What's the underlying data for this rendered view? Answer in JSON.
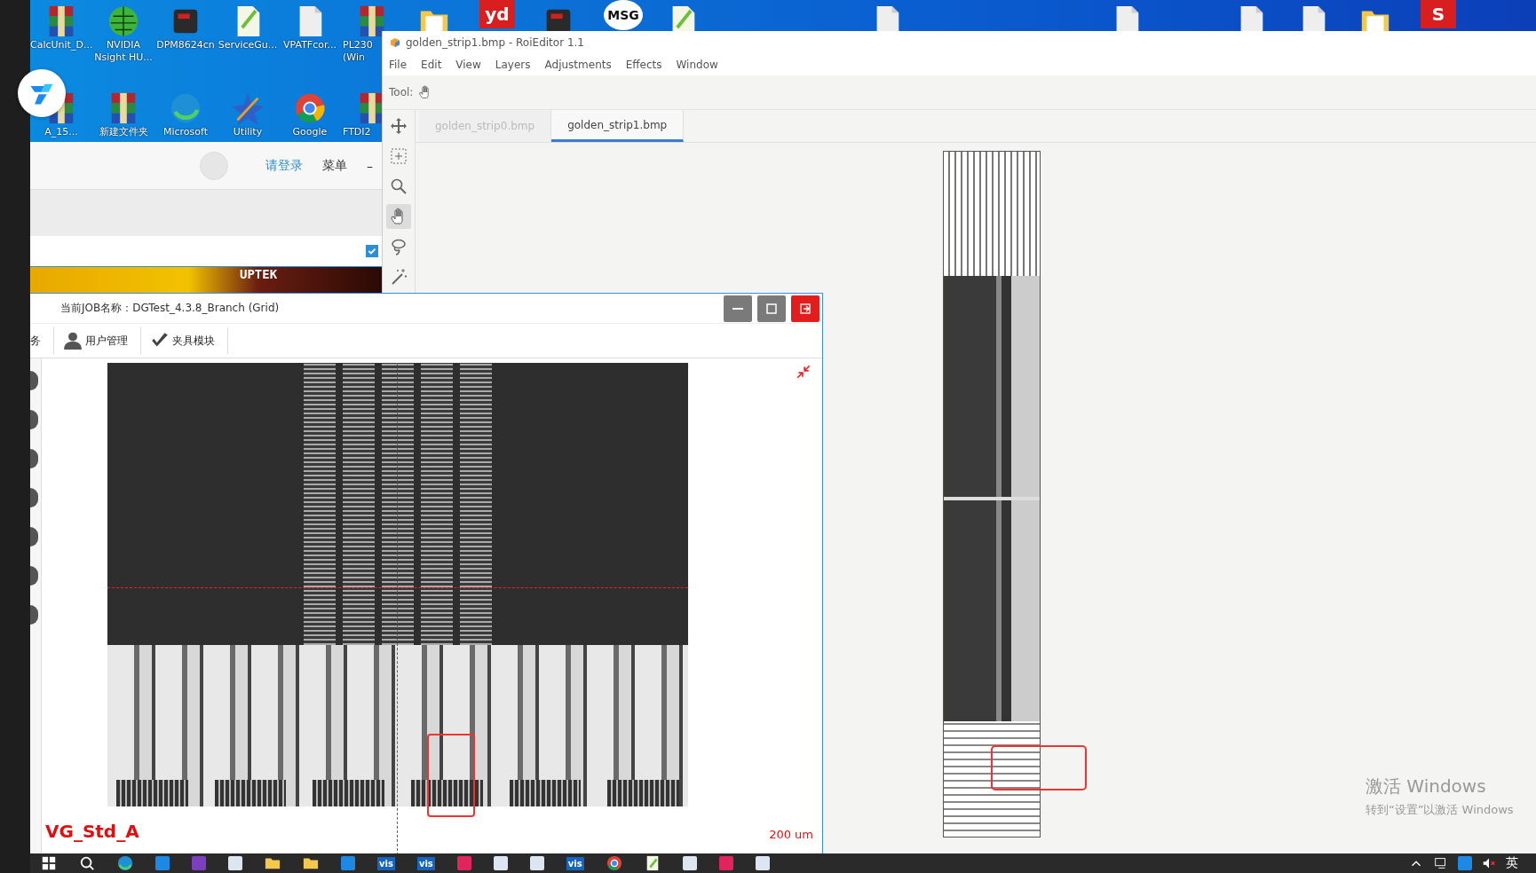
{
  "desktop": {
    "icons": [
      {
        "label": "CalcUnit_D...",
        "kind": "archive"
      },
      {
        "label": "NVIDIA Nsight HU...",
        "kind": "sphere"
      },
      {
        "label": "DPM8624cn",
        "kind": "device"
      },
      {
        "label": "ServiceGu...",
        "kind": "notepad"
      },
      {
        "label": "VPATFcor...",
        "kind": "file"
      },
      {
        "label": "PL230 (Win",
        "kind": "archive"
      },
      {
        "label": "A_15...",
        "kind": "archive"
      },
      {
        "label": "新建文件夹",
        "kind": "archive"
      },
      {
        "label": "Microsoft",
        "kind": "swirl"
      },
      {
        "label": "Utility",
        "kind": "tools"
      },
      {
        "label": "Google",
        "kind": "ring"
      },
      {
        "label": "FTDI2",
        "kind": "archive"
      }
    ],
    "top_icons": [
      {
        "kind": "folder"
      },
      {
        "kind": "tile",
        "label": "yd"
      },
      {
        "kind": "device"
      },
      {
        "kind": "badge",
        "label": "MSG"
      },
      {
        "kind": "notepad"
      },
      {
        "kind": "file"
      },
      {
        "kind": "file"
      },
      {
        "kind": "file"
      },
      {
        "kind": "file"
      },
      {
        "kind": "folder"
      },
      {
        "kind": "tile",
        "label": "S"
      }
    ]
  },
  "roi_editor": {
    "title": "golden_strip1.bmp - RoiEditor 1.1",
    "menu": [
      "File",
      "Edit",
      "View",
      "Layers",
      "Adjustments",
      "Effects",
      "Window"
    ],
    "tool_label": "Tool:",
    "tabs": [
      {
        "label": "golden_strip0.bmp",
        "selected": false
      },
      {
        "label": "golden_strip1.bmp",
        "selected": true
      }
    ],
    "tools": [
      {
        "kind": "move",
        "selected": false
      },
      {
        "kind": "select",
        "selected": false
      },
      {
        "kind": "zoom",
        "selected": false
      },
      {
        "kind": "hand",
        "selected": true
      },
      {
        "kind": "lasso",
        "selected": false
      },
      {
        "kind": "wand",
        "selected": false
      }
    ]
  },
  "background_app": {
    "login_link": "请登录",
    "menu_label": "菜单",
    "minimize_label": "–",
    "checked": true,
    "banner_text": "UPTEK"
  },
  "inspection": {
    "title": "当前JOB名称：DGTest_4.3.8_Branch (Grid)",
    "toolbar": [
      {
        "label": "务",
        "kind": "text"
      },
      {
        "label": "用户管理",
        "kind": "user"
      },
      {
        "label": "夹具模块",
        "kind": "fixture"
      }
    ],
    "overlay_label": "VG_Std_A",
    "scale_label": "200 um"
  },
  "activation": {
    "heading": "激活 Windows",
    "hint": "转到“设置”以激活 Windows"
  },
  "taskbar": {
    "apps": [
      {
        "kind": "start"
      },
      {
        "kind": "search"
      },
      {
        "kind": "swirl"
      },
      {
        "kind": "tile-blue"
      },
      {
        "kind": "tile-purple"
      },
      {
        "kind": "tile-white"
      },
      {
        "kind": "folder"
      },
      {
        "kind": "folder"
      },
      {
        "kind": "tile-blue"
      },
      {
        "kind": "text",
        "label": "vis"
      },
      {
        "kind": "text",
        "label": "vis"
      },
      {
        "kind": "tile-red"
      },
      {
        "kind": "tile-white"
      },
      {
        "kind": "tile-white"
      },
      {
        "kind": "text",
        "label": "vis"
      },
      {
        "kind": "ring"
      },
      {
        "kind": "notepad"
      },
      {
        "kind": "tile-white"
      },
      {
        "kind": "tile-red"
      },
      {
        "kind": "tile-white"
      }
    ],
    "ime": "英"
  }
}
